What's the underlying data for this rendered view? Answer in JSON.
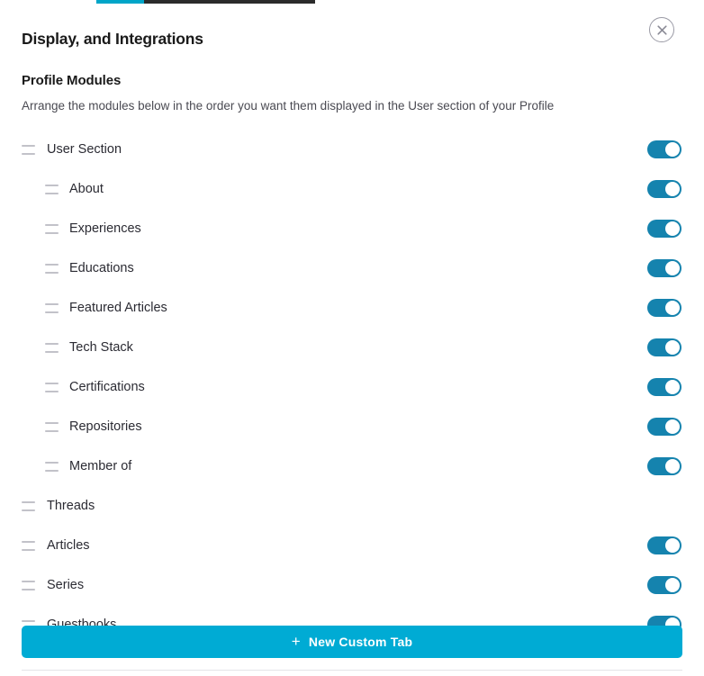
{
  "tabstrip": {
    "active_color": "#00A5C8",
    "rest_color": "#2b2b2b"
  },
  "header": {
    "title": "Display, and Integrations",
    "close_label": "Close",
    "close_icon": "close-icon"
  },
  "section": {
    "title": "Profile Modules",
    "description": "Arrange the modules below in the order you want them displayed in the User section of your Profile"
  },
  "theme": {
    "toggle_on_color": "#1583AE",
    "button_color": "#00ABD4",
    "text_color": "#2b2b33",
    "handle_color": "#c2c2c9"
  },
  "modules": [
    {
      "label": "User Section",
      "level": 0,
      "toggle": "on",
      "has_toggle": true
    },
    {
      "label": "About",
      "level": 1,
      "toggle": "on",
      "has_toggle": true
    },
    {
      "label": "Experiences",
      "level": 1,
      "toggle": "on",
      "has_toggle": true
    },
    {
      "label": "Educations",
      "level": 1,
      "toggle": "on",
      "has_toggle": true
    },
    {
      "label": "Featured Articles",
      "level": 1,
      "toggle": "on",
      "has_toggle": true
    },
    {
      "label": "Tech Stack",
      "level": 1,
      "toggle": "on",
      "has_toggle": true
    },
    {
      "label": "Certifications",
      "level": 1,
      "toggle": "on",
      "has_toggle": true
    },
    {
      "label": "Repositories",
      "level": 1,
      "toggle": "on",
      "has_toggle": true
    },
    {
      "label": "Member of",
      "level": 1,
      "toggle": "on",
      "has_toggle": true
    },
    {
      "label": "Threads",
      "level": 0,
      "toggle": null,
      "has_toggle": false
    },
    {
      "label": "Articles",
      "level": 0,
      "toggle": "on",
      "has_toggle": true
    },
    {
      "label": "Series",
      "level": 0,
      "toggle": "on",
      "has_toggle": true
    },
    {
      "label": "Guestbooks",
      "level": 0,
      "toggle": "on",
      "has_toggle": true
    }
  ],
  "footer": {
    "new_tab_label": "New Custom Tab",
    "new_tab_icon": "plus-icon",
    "plus_glyph": "+"
  }
}
